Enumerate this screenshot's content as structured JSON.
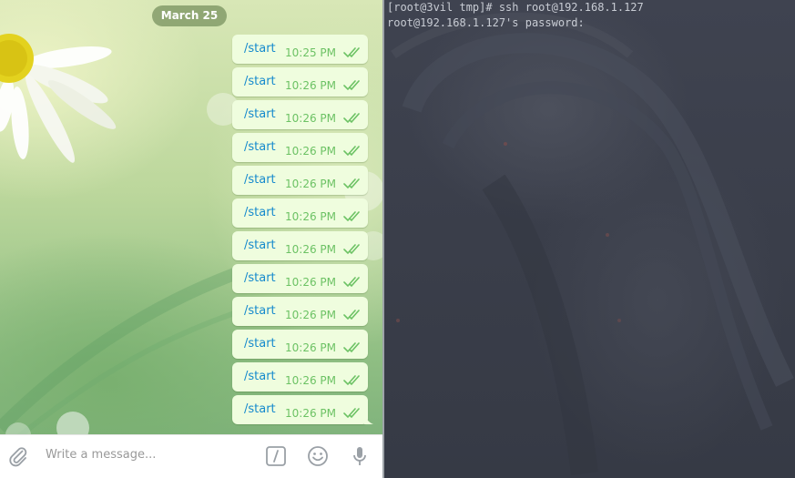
{
  "chat": {
    "date": "March 25",
    "messages": [
      {
        "text": "/start",
        "time": "10:25 PM"
      },
      {
        "text": "/start",
        "time": "10:26 PM"
      },
      {
        "text": "/start",
        "time": "10:26 PM"
      },
      {
        "text": "/start",
        "time": "10:26 PM"
      },
      {
        "text": "/start",
        "time": "10:26 PM"
      },
      {
        "text": "/start",
        "time": "10:26 PM"
      },
      {
        "text": "/start",
        "time": "10:26 PM"
      },
      {
        "text": "/start",
        "time": "10:26 PM"
      },
      {
        "text": "/start",
        "time": "10:26 PM"
      },
      {
        "text": "/start",
        "time": "10:26 PM"
      },
      {
        "text": "/start",
        "time": "10:26 PM"
      },
      {
        "text": "/start",
        "time": "10:26 PM"
      }
    ],
    "composer": {
      "placeholder": "Write a message...",
      "icons": [
        "paperclip-icon",
        "bot-command-icon",
        "emoji-icon",
        "microphone-icon"
      ]
    },
    "colors": {
      "bubble": "#effdde",
      "command": "#168acd",
      "time": "#6cc264",
      "date_pill": "#7a9160"
    }
  },
  "terminal": {
    "lines": [
      "[root@3vil tmp]# ssh root@192.168.1.127",
      "root@192.168.1.127's password:"
    ],
    "colors": {
      "text": "#c8ccd4",
      "background": "#3a3e4a"
    }
  }
}
